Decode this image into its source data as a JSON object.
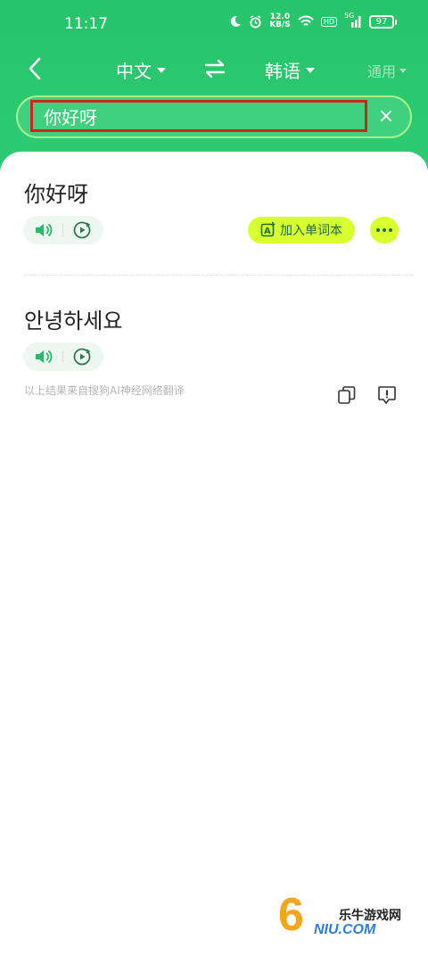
{
  "status_bar": {
    "time": "11:17",
    "speed_value": "12.0",
    "speed_unit": "KB/S",
    "battery": "97",
    "hd_label": "HD",
    "network_label": "5G"
  },
  "nav": {
    "source_language": "中文",
    "target_language": "韩语",
    "mode": "通用"
  },
  "search": {
    "value": "你好呀",
    "clear_label": "×"
  },
  "result": {
    "source_text": "你好呀",
    "add_to_wordbook": "加入单词本",
    "translated_text": "안녕하세요",
    "source_note": "以上结果来自搜狗AI神经网络翻译"
  },
  "watermark": {
    "digit": "6",
    "cn": "乐牛游戏网",
    "en": "NIU.COM"
  },
  "colors": {
    "header_green": "#2ecb74",
    "accent_yellow": "#d8ff2e",
    "highlight_red": "#c9261d"
  }
}
